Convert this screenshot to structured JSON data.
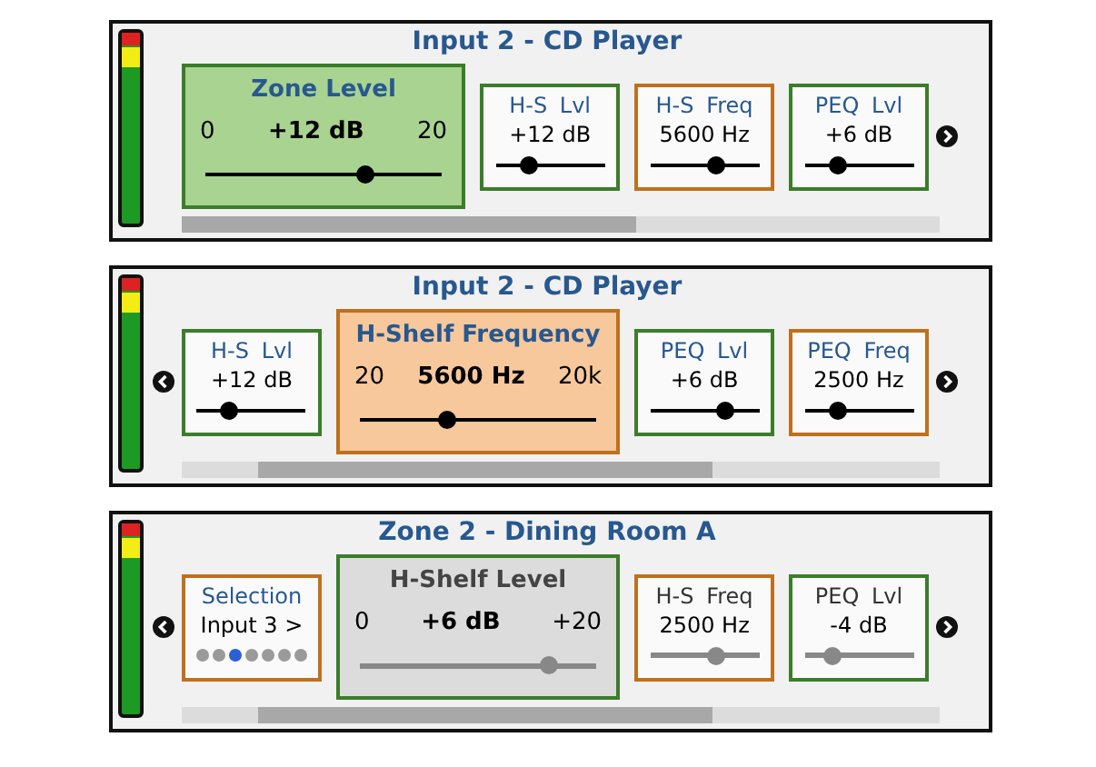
{
  "panels": [
    {
      "title": "Input 2 - CD Player",
      "scroll_left": false,
      "scroll_right": true,
      "cards": [
        {
          "kind": "large",
          "title": "Zone Level",
          "min": "0",
          "value": "+12 dB",
          "max": "20",
          "level": 0.68,
          "color": "#3b7d2a",
          "disabled": false
        },
        {
          "kind": "small",
          "title": "H-S Lvl",
          "value": "+12 dB",
          "level": 0.3,
          "color": "#3b7d2a",
          "disabled": false
        },
        {
          "kind": "small",
          "title": "H-S Freq",
          "value": "5600 Hz",
          "level": 0.6,
          "color": "#c0701c",
          "disabled": false
        },
        {
          "kind": "small",
          "title": "PEQ Lvl",
          "value": "+6 dB",
          "level": 0.3,
          "color": "#3b7d2a",
          "disabled": false
        }
      ]
    },
    {
      "title": "Input 2 - CD Player",
      "scroll_left": true,
      "scroll_right": true,
      "cards": [
        {
          "kind": "small",
          "title": "H-S Lvl",
          "value": "+12 dB",
          "level": 0.29,
          "color": "#3b7d2a",
          "disabled": false
        },
        {
          "kind": "large",
          "title": "H-Shelf Frequency",
          "min": "20",
          "value": "5600 Hz",
          "max": "20k",
          "level": 0.37,
          "color": "#c0701c",
          "disabled": false
        },
        {
          "kind": "small",
          "title": "PEQ Lvl",
          "value": "+6 dB",
          "level": 0.69,
          "color": "#3b7d2a",
          "disabled": false
        },
        {
          "kind": "small",
          "title": "PEQ Freq",
          "value": "2500 Hz",
          "level": 0.3,
          "color": "#c0701c",
          "disabled": false
        }
      ]
    },
    {
      "title": "Zone 2 - Dining Room A",
      "scroll_left": true,
      "scroll_right": true,
      "cards": [
        {
          "kind": "selection",
          "title": "Selection",
          "value": "Input 3 >",
          "color": "#c0701c",
          "disabled": false,
          "dots": [
            {
              "selected": false
            },
            {
              "selected": false
            },
            {
              "selected": true
            },
            {
              "selected": false
            },
            {
              "selected": false
            },
            {
              "selected": false
            },
            {
              "selected": false
            }
          ]
        },
        {
          "kind": "large",
          "title": "H-Shelf Level",
          "min": "0",
          "value": "+6 dB",
          "max": "+20",
          "level": 0.8,
          "color": "#3b7d2a",
          "disabled": true
        },
        {
          "kind": "small",
          "title": "H-S Freq",
          "value": "2500 Hz",
          "level": 0.6,
          "color": "#c0701c",
          "disabled": true
        },
        {
          "kind": "small",
          "title": "PEQ Lvl",
          "value": "-4 dB",
          "level": 0.25,
          "color": "#3b7d2a",
          "disabled": true
        }
      ]
    }
  ]
}
